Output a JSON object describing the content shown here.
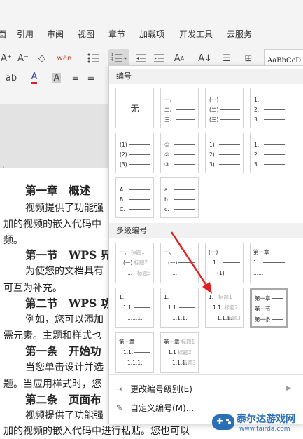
{
  "ribbon": {
    "tabs": [
      "引用",
      "审阅",
      "视图",
      "章节",
      "加载项",
      "开发工具",
      "云服务"
    ],
    "toolbar": {
      "font_increase": "A⁺",
      "font_decrease": "A⁻",
      "eraser": "◇",
      "phonetic": "wén",
      "style_preview": "AaBbCcD"
    }
  },
  "dropdown": {
    "section_numbering": "编号",
    "section_multilevel": "多级编号",
    "none_label": "无",
    "numbering": [
      [
        "一、",
        "二、",
        "三、"
      ],
      [
        "(一)",
        "(二)",
        "(三)"
      ],
      [
        "1.",
        "2.",
        "3."
      ],
      [
        "(1)",
        "(2)",
        "(3)"
      ],
      [
        "①",
        "②",
        "③"
      ],
      [
        "1)",
        "2)",
        "3)"
      ],
      [
        "1.",
        "2.",
        "3."
      ],
      [
        "A.",
        "B.",
        "C."
      ],
      [
        "a.",
        "b.",
        "c."
      ]
    ],
    "multilevel": [
      [
        {
          "m": "一、",
          "t": "标题1"
        },
        {
          "m": "(一)",
          "t": "标题2"
        },
        {
          "m": "1.",
          "t": "标题3"
        }
      ],
      [
        {
          "m": "一、",
          "t": ""
        },
        {
          "m": "(一)",
          "t": ""
        },
        {
          "m": "1.",
          "t": ""
        }
      ],
      [
        {
          "m": "(一)",
          "t": ""
        },
        {
          "m": "1.",
          "t": ""
        },
        {
          "m": "(1)",
          "t": ""
        }
      ],
      [
        {
          "m": "第一章",
          "t": ""
        },
        {
          "m": "1.",
          "t": ""
        },
        {
          "m": "1.1.",
          "t": ""
        }
      ],
      [
        {
          "m": "1.",
          "t": ""
        },
        {
          "m": "1.1.",
          "t": ""
        },
        {
          "m": "1.1.1.",
          "t": ""
        }
      ],
      [
        {
          "m": "1.",
          "t": ""
        },
        {
          "m": "1.1.",
          "t": ""
        },
        {
          "m": "1.1.1.",
          "t": ""
        }
      ],
      [
        {
          "m": "1.",
          "t": "标题1"
        },
        {
          "m": "1.1.",
          "t": "标题2"
        },
        {
          "m": "1.1.1.",
          "t": "标题3"
        }
      ],
      [
        {
          "m": "第一章",
          "t": ""
        },
        {
          "m": "第一节",
          "t": ""
        },
        {
          "m": "第一条",
          "t": ""
        }
      ],
      [
        {
          "m": "第一章",
          "t": ""
        },
        {
          "m": "1.1.",
          "t": ""
        },
        {
          "m": "1.1.1.",
          "t": ""
        }
      ],
      [
        {
          "m": "第一章",
          "t": "标题1"
        },
        {
          "m": "1.1",
          "t": "标题2"
        },
        {
          "m": "1.1.1.",
          "t": "标题3"
        }
      ]
    ],
    "change_level": "更改编号级别(E)",
    "custom_numbering": "自定义编号(M)..."
  },
  "document": {
    "lines": [
      {
        "text": "第一章　概述",
        "heading": true
      },
      {
        "text": "视频提供了功能强",
        "heading": false
      },
      {
        "text": "加的视频的嵌入代码中",
        "heading": false
      },
      {
        "text": "频。",
        "heading": false
      },
      {
        "text": "第一节　WPS 界",
        "heading": true
      },
      {
        "text": "为使您的文档具有",
        "heading": false
      },
      {
        "text": "可互为补充。",
        "heading": false
      },
      {
        "text": "第二节　WPS 功",
        "heading": true
      },
      {
        "text": "例如，您可以添加",
        "heading": false
      },
      {
        "text": "需元素。主题和样式也",
        "heading": false
      },
      {
        "text": "第一条　开始功",
        "heading": true
      },
      {
        "text": "当您单击设计并选",
        "heading": false
      },
      {
        "text": "题。当应用样式时，您",
        "heading": false
      },
      {
        "text": "第二条　页面布",
        "heading": true
      },
      {
        "text": "视频提供了功能强",
        "heading": false
      },
      {
        "text": "加的视频的嵌入代码中进行粘贴。您也可以",
        "heading": false
      }
    ]
  },
  "watermark": {
    "title": "泰尔达游戏网",
    "url": "www.tairda.com"
  },
  "colors": {
    "annotation_arrow": "#e02020",
    "watermark_blue": "#2a6fb8",
    "selection_border": "#a8a8a8"
  }
}
